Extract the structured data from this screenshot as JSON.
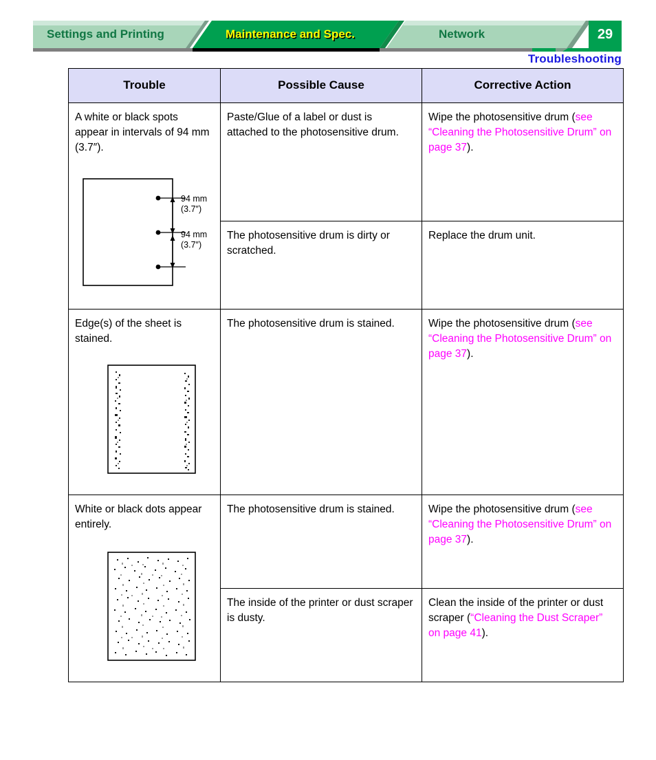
{
  "header": {
    "tabs": [
      {
        "label": "Settings and Printing",
        "active": false
      },
      {
        "label": "Maintenance and Spec.",
        "active": true
      },
      {
        "label": "Network",
        "active": false
      }
    ],
    "page_number": "29",
    "section_title": "Troubleshooting",
    "colors": {
      "tab_inactive_bg": "#a8d5b9",
      "tab_inactive_text": "#117744",
      "tab_active_bg": "#00a050",
      "tab_active_text": "#ffff00",
      "badge_bg": "#00a050",
      "badge_text": "#ffffff",
      "section_title": "#1a1ae0",
      "shadow": "#7f7f7f"
    }
  },
  "table": {
    "columns": [
      "Trouble",
      "Possible Cause",
      "Corrective Action"
    ],
    "header_bg": "#dcdcf8",
    "link_color": "#ff00ff",
    "rows": [
      {
        "trouble": "A white or black spots appear in intervals of 94 mm (3.7″).",
        "figure": "interval-spots-diagram",
        "figure_labels": {
          "top": {
            "line1": "94 mm",
            "line2": "(3.7″)"
          },
          "bottom": {
            "line1": "94 mm",
            "line2": "(3.7″)"
          }
        },
        "causes": [
          {
            "cause": "Paste/Glue of a label or dust is attached to the photosensitive drum.",
            "action_pre": "Wipe the photosensitive drum (",
            "action_link": "see “Cleaning the Photosensitive Drum” on page 37",
            "action_post": ")."
          },
          {
            "cause": "The photosensitive drum is dirty or scratched.",
            "action_pre": "Replace the drum unit.",
            "action_link": "",
            "action_post": ""
          }
        ]
      },
      {
        "trouble": "Edge(s) of the sheet is stained.",
        "figure": "edge-stained-page-diagram",
        "causes": [
          {
            "cause": "The photosensitive drum is stained.",
            "action_pre": "Wipe the photosensitive drum (",
            "action_link": "see “Cleaning the Photosensitive Drum” on page 37",
            "action_post": ")."
          }
        ]
      },
      {
        "trouble": "White or black dots appear entirely.",
        "figure": "scattered-dots-page-diagram",
        "causes": [
          {
            "cause": "The photosensitive drum is stained.",
            "action_pre": "Wipe the photosensitive drum (",
            "action_link": "see “Cleaning the Photosensitive Drum” on page 37",
            "action_post": ")."
          },
          {
            "cause": "The inside of the printer or dust scraper is dusty.",
            "action_pre": "Clean the inside of the printer or dust scraper (",
            "action_link": "“Cleaning the Dust Scraper” on page 41",
            "action_post": ")."
          }
        ]
      }
    ]
  }
}
